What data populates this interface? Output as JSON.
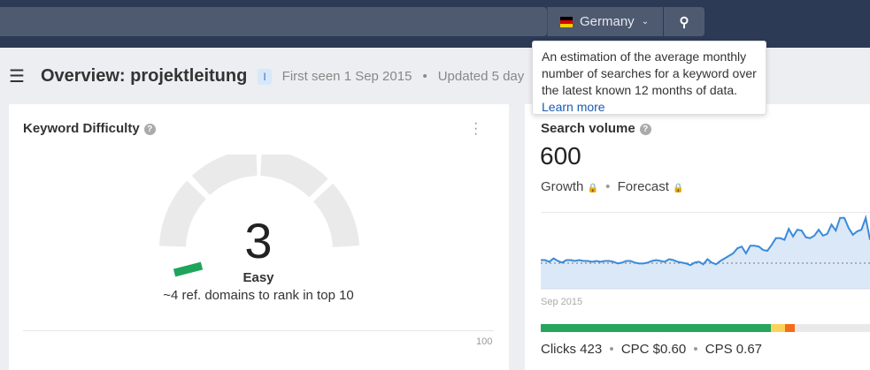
{
  "topbar": {
    "country": "Germany",
    "country_flag": "germany-flag",
    "search_icon": "search-icon"
  },
  "header": {
    "title": "Overview: projektleitung",
    "badge": "I",
    "first_seen": "First seen 1 Sep 2015",
    "updated": "Updated 5 day"
  },
  "tooltip": {
    "text": "An estimation of the average monthly number of searches for a keyword over the latest known 12 months of data.",
    "link": "Learn more"
  },
  "difficulty": {
    "title": "Keyword Difficulty",
    "value": "3",
    "level": "Easy",
    "subtitle": "~4 ref. domains to rank in top 10",
    "scale_max": "100",
    "fill_percent": 3,
    "color": "#1fa55b"
  },
  "volume": {
    "title": "Search volume",
    "value": "600",
    "growth": "Growth",
    "forecast": "Forecast",
    "x_label": "Sep 2015",
    "stats": {
      "clicks": "Clicks 423",
      "cpc": "CPC $0.60",
      "cps": "CPS 0.67"
    },
    "click_bar": [
      {
        "color": "#27a55d",
        "percent": 70
      },
      {
        "color": "#fbd35a",
        "percent": 4.3
      },
      {
        "color": "#f46d19",
        "percent": 2.9
      }
    ]
  },
  "chart_data": {
    "type": "area",
    "x_start": "Sep 2015",
    "color": "#3b8ad9",
    "values": [
      34,
      34,
      32,
      36,
      33,
      31,
      34,
      34,
      33,
      34,
      33,
      33,
      32,
      33,
      32,
      33,
      33,
      32,
      30,
      31,
      33,
      33,
      31,
      30,
      30,
      31,
      33,
      34,
      33,
      32,
      35,
      34,
      32,
      31,
      30,
      28,
      31,
      32,
      29,
      35,
      31,
      29,
      33,
      36,
      39,
      42,
      48,
      50,
      42,
      51,
      51,
      50,
      46,
      45,
      52,
      60,
      60,
      58,
      71,
      62,
      70,
      69,
      61,
      60,
      63,
      70,
      63,
      65,
      76,
      69,
      84,
      84,
      72,
      64,
      68,
      70,
      84,
      58
    ]
  }
}
